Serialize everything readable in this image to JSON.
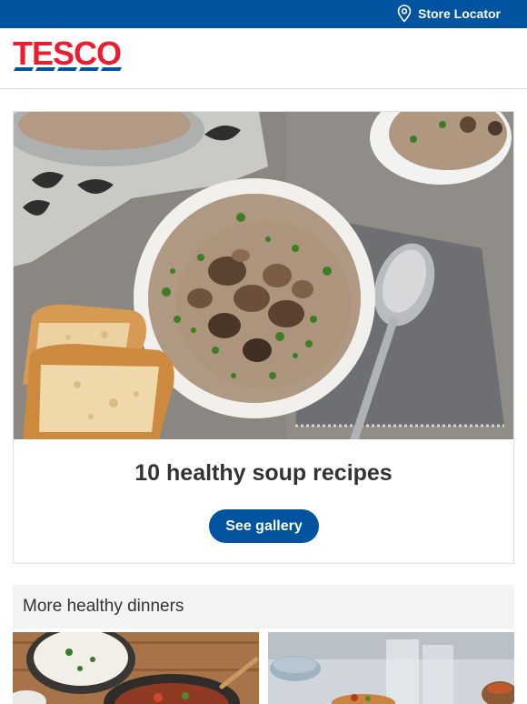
{
  "topbar": {
    "store_locator_label": "Store Locator",
    "icon": "location-pin-icon"
  },
  "brand": {
    "logo_text": "TESCO",
    "logo_red": "#ee1c2e",
    "logo_blue": "#00539f"
  },
  "feature": {
    "image": "mushroom soup bowl with bread and spoon",
    "title": "10 healthy soup recipes",
    "cta_label": "See gallery"
  },
  "more_section": {
    "title": "More healthy dinners",
    "items": [
      {
        "image": "rice bowl and stew in pan on wooden board"
      },
      {
        "image": "tacos on table with glasses of water"
      }
    ]
  },
  "colors": {
    "primary_blue": "#00539f",
    "section_bg": "#f3f3f3"
  }
}
